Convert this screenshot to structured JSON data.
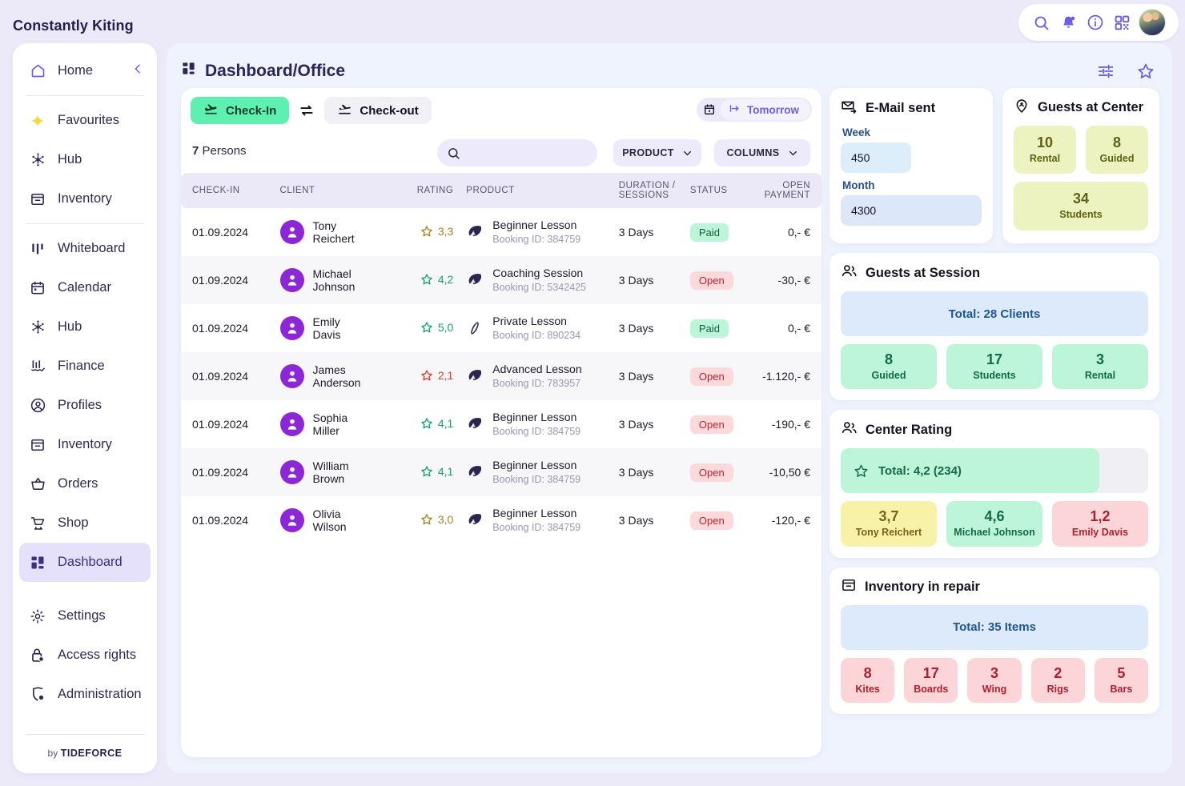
{
  "brand": "Constantly Kiting",
  "topbar_icons": [
    "search-icon",
    "bell-icon",
    "info-icon",
    "qr-icon",
    "avatar"
  ],
  "sidebar": {
    "home": {
      "label": "Home",
      "icon": "home-icon"
    },
    "groups": [
      [
        {
          "label": "Favourites",
          "icon": "sparkle-icon"
        },
        {
          "label": "Hub",
          "icon": "hub-icon"
        },
        {
          "label": "Inventory",
          "icon": "inventory-icon"
        }
      ],
      [
        {
          "label": "Whiteboard",
          "icon": "whiteboard-icon"
        },
        {
          "label": "Calendar",
          "icon": "calendar-icon"
        },
        {
          "label": "Hub",
          "icon": "hub-icon"
        },
        {
          "label": "Finance",
          "icon": "finance-icon"
        },
        {
          "label": "Profiles",
          "icon": "profile-icon"
        },
        {
          "label": "Inventory",
          "icon": "inventory-icon"
        },
        {
          "label": "Orders",
          "icon": "orders-icon"
        },
        {
          "label": "Shop",
          "icon": "shop-icon"
        },
        {
          "label": "Dashboard",
          "icon": "dashboard-icon",
          "active": true
        }
      ],
      [
        {
          "label": "Settings",
          "icon": "gear-icon"
        },
        {
          "label": "Access rights",
          "icon": "lock-icon"
        },
        {
          "label": "Administration",
          "icon": "shield-icon"
        }
      ]
    ],
    "footer_by": "by",
    "footer_brand": "TIDEFORCE"
  },
  "page": {
    "title": "Dashboard/Office",
    "title_icon": "dashboard-icon",
    "actions": [
      "sliders-icon",
      "star-icon"
    ]
  },
  "toolbar": {
    "checkin_label": "Check-In",
    "checkin_icon": "plane-arrival-icon",
    "swap_icon": "swap-icon",
    "checkout_label": "Check-out",
    "checkout_icon": "plane-departure-icon",
    "calendar_icon": "calendar-icon",
    "date_label": "Tomorrow",
    "date_icon": "arrow-to-right-icon"
  },
  "filters": {
    "count": "7",
    "count_label": "Persons",
    "search_placeholder": "",
    "search_value": "",
    "search_icon": "search-icon",
    "product_label": "PRODUCT",
    "columns_label": "COLUMNS"
  },
  "table": {
    "columns": [
      "CHECK-IN",
      "CLIENT",
      "RATING",
      "PRODUCT",
      "DURATION / SESSIONS",
      "STATUS",
      "OPEN PAYMENT"
    ],
    "rows": [
      {
        "date": "01.09.2024",
        "first": "Tony",
        "last": "Reichert",
        "rating": "3,3",
        "rating_color": "#a6811a",
        "product": "Beginner Lesson",
        "booking": "Booking ID: 384759",
        "product_icon": "kite-icon",
        "duration": "3 Days",
        "status": "Paid",
        "status_kind": "paid",
        "payment": "0,- €",
        "payment_kind": "zero"
      },
      {
        "date": "01.09.2024",
        "first": "Michael",
        "last": "Johnson",
        "rating": "4,2",
        "rating_color": "#13a06e",
        "product": "Coaching Session",
        "booking": "Booking ID: 5342425",
        "product_icon": "kite-icon",
        "duration": "3 Days",
        "status": "Open",
        "status_kind": "open",
        "payment": "-30,- €",
        "payment_kind": "neg"
      },
      {
        "date": "01.09.2024",
        "first": "Emily",
        "last": "Davis",
        "rating": "5,0",
        "rating_color": "#13a06e",
        "product": "Private Lesson",
        "booking": "Booking ID: 890234",
        "product_icon": "board-icon",
        "duration": "3 Days",
        "status": "Paid",
        "status_kind": "paid",
        "payment": "0,- €",
        "payment_kind": "zero"
      },
      {
        "date": "01.09.2024",
        "first": "James",
        "last": "Anderson",
        "rating": "2,1",
        "rating_color": "#e0392f",
        "product": "Advanced Lesson",
        "booking": "Booking ID: 783957",
        "product_icon": "kite-icon",
        "duration": "3 Days",
        "status": "Open",
        "status_kind": "open",
        "payment": "-1.120,- €",
        "payment_kind": "neg"
      },
      {
        "date": "01.09.2024",
        "first": "Sophia",
        "last": "Miller",
        "rating": "4,1",
        "rating_color": "#13a06e",
        "product": "Beginner Lesson",
        "booking": "Booking ID: 384759",
        "product_icon": "kite-icon",
        "duration": "3 Days",
        "status": "Open",
        "status_kind": "open",
        "payment": "-190,- €",
        "payment_kind": "neg"
      },
      {
        "date": "01.09.2024",
        "first": "William",
        "last": "Brown",
        "rating": "4,1",
        "rating_color": "#13a06e",
        "product": "Beginner Lesson",
        "booking": "Booking ID: 384759",
        "product_icon": "kite-icon",
        "duration": "3 Days",
        "status": "Open",
        "status_kind": "open",
        "payment": "-10,50 €",
        "payment_kind": "neg"
      },
      {
        "date": "01.09.2024",
        "first": "Olivia",
        "last": "Wilson",
        "rating": "3,0",
        "rating_color": "#a6811a",
        "product": "Beginner Lesson",
        "booking": "Booking ID: 384759",
        "product_icon": "kite-icon",
        "duration": "3 Days",
        "status": "Open",
        "status_kind": "open",
        "payment": "-120,- €",
        "payment_kind": "neg"
      }
    ]
  },
  "email_sent": {
    "title": "E-Mail sent",
    "icon": "mail-sent-icon",
    "week_label": "Week",
    "week_value": "450",
    "month_label": "Month",
    "month_value": "4300"
  },
  "guests_center": {
    "title": "Guests at Center",
    "icon": "pin-user-icon",
    "tiles": [
      {
        "value": "10",
        "label": "Rental"
      },
      {
        "value": "8",
        "label": "Guided"
      },
      {
        "value": "34",
        "label": "Students"
      }
    ]
  },
  "guests_session": {
    "title": "Guests at Session",
    "icon": "users-icon",
    "total": "Total: 28 Clients",
    "tiles": [
      {
        "value": "8",
        "label": "Guided"
      },
      {
        "value": "17",
        "label": "Students"
      },
      {
        "value": "3",
        "label": "Rental"
      }
    ]
  },
  "center_rating": {
    "title": "Center Rating",
    "icon": "users-icon",
    "star_icon": "star-icon",
    "total": "Total: 4,2 (234)",
    "fill_percent": 84,
    "tiles": [
      {
        "value": "3,7",
        "label": "Tony Reichert",
        "kind": "yellow2"
      },
      {
        "value": "4,6",
        "label": "Michael Johnson",
        "kind": "green"
      },
      {
        "value": "1,2",
        "label": "Emily Davis",
        "kind": "red"
      }
    ]
  },
  "inventory_repair": {
    "title": "Inventory in repair",
    "icon": "inventory-icon",
    "total": "Total: 35 Items",
    "tiles": [
      {
        "value": "8",
        "label": "Kites"
      },
      {
        "value": "17",
        "label": "Boards"
      },
      {
        "value": "3",
        "label": "Wing"
      },
      {
        "value": "2",
        "label": "Rigs"
      },
      {
        "value": "5",
        "label": "Bars"
      }
    ]
  }
}
